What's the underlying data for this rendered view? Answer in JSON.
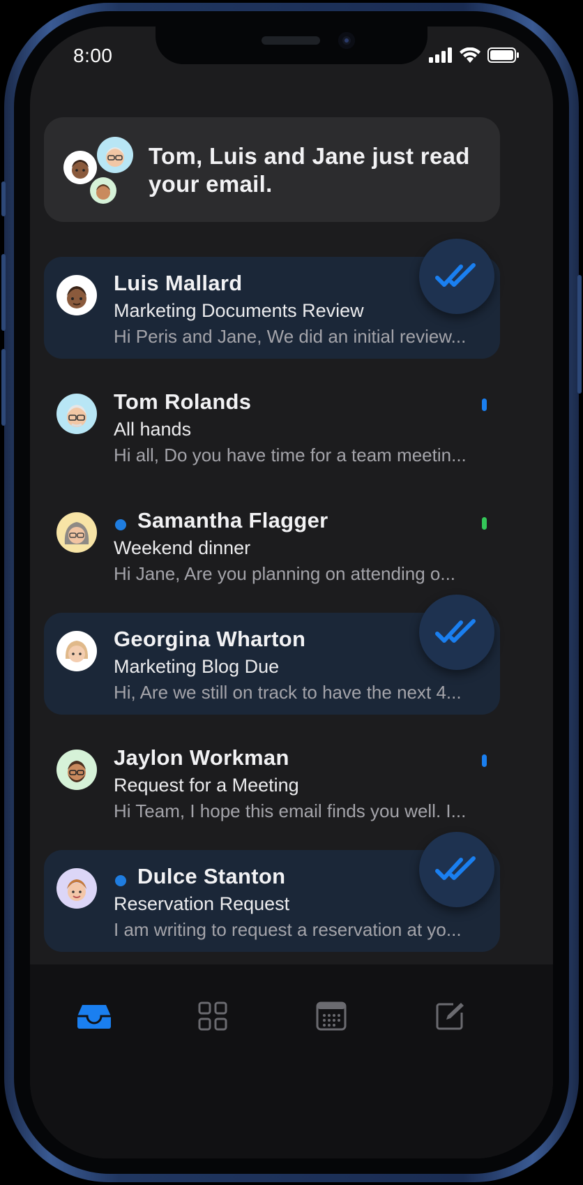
{
  "status_bar": {
    "time": "8:00",
    "icons": [
      "cellular-signal-icon",
      "wifi-icon",
      "battery-icon"
    ]
  },
  "toast": {
    "message": "Tom, Luis and Jane just read your email.",
    "avatars": [
      "luis-avatar",
      "tom-avatar",
      "jaylon-avatar"
    ]
  },
  "emails": [
    {
      "sender": "Luis Mallard",
      "subject": "Marketing Documents Review",
      "preview": "Hi Peris and Jane, We did an initial review...",
      "read_receipt": true,
      "unread_dot": false,
      "flag": null,
      "avatar_bg": "#ffffff"
    },
    {
      "sender": "Tom Rolands",
      "subject": "All hands",
      "preview": "Hi all, Do you have time for a team meetin...",
      "read_receipt": false,
      "unread_dot": false,
      "flag": "#1a7ff0",
      "avatar_bg": "#b8e6f5"
    },
    {
      "sender": "Samantha Flagger",
      "subject": "Weekend dinner",
      "preview": "Hi Jane, Are you planning on attending o...",
      "read_receipt": false,
      "unread_dot": true,
      "flag": "#34c759",
      "avatar_bg": "#f7e4a6"
    },
    {
      "sender": "Georgina Wharton",
      "subject": "Marketing Blog Due",
      "preview": "Hi, Are we still on track to have the next 4...",
      "read_receipt": true,
      "unread_dot": false,
      "flag": null,
      "avatar_bg": "#ffffff"
    },
    {
      "sender": "Jaylon Workman",
      "subject": "Request for a Meeting",
      "preview": "Hi Team, I hope this email finds you well. I...",
      "read_receipt": false,
      "unread_dot": false,
      "flag": "#1a7ff0",
      "avatar_bg": "#d6f2d8"
    },
    {
      "sender": "Dulce Stanton",
      "subject": "Reservation Request",
      "preview": "I am writing to request a reservation at yo...",
      "read_receipt": true,
      "unread_dot": true,
      "flag": null,
      "avatar_bg": "#dcd6f7"
    }
  ],
  "tab_bar": {
    "tabs": [
      {
        "icon": "inbox-tray-icon",
        "active": true
      },
      {
        "icon": "grid-icon",
        "active": false
      },
      {
        "icon": "calendar-icon",
        "active": false
      },
      {
        "icon": "compose-icon",
        "active": false
      }
    ]
  },
  "colors": {
    "accent": "#1a7ff0",
    "background": "#1c1c1e",
    "read_row": "#1b2738",
    "toast": "#2c2c2e"
  }
}
